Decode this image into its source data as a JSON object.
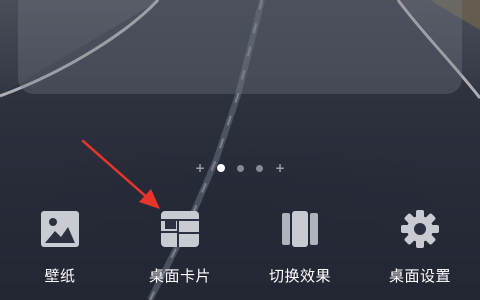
{
  "page_indicator": {
    "pages": 3,
    "active_index": 0,
    "add_symbol": "+"
  },
  "menu": {
    "items": [
      {
        "label": "壁纸",
        "icon": "image-icon"
      },
      {
        "label": "桌面卡片",
        "icon": "widget-cards-icon"
      },
      {
        "label": "切换效果",
        "icon": "transition-effect-icon"
      },
      {
        "label": "桌面设置",
        "icon": "gear-icon"
      }
    ]
  },
  "colors": {
    "icon": "#c9cbd2",
    "label": "#ffffff",
    "arrow": "#e8352b"
  }
}
